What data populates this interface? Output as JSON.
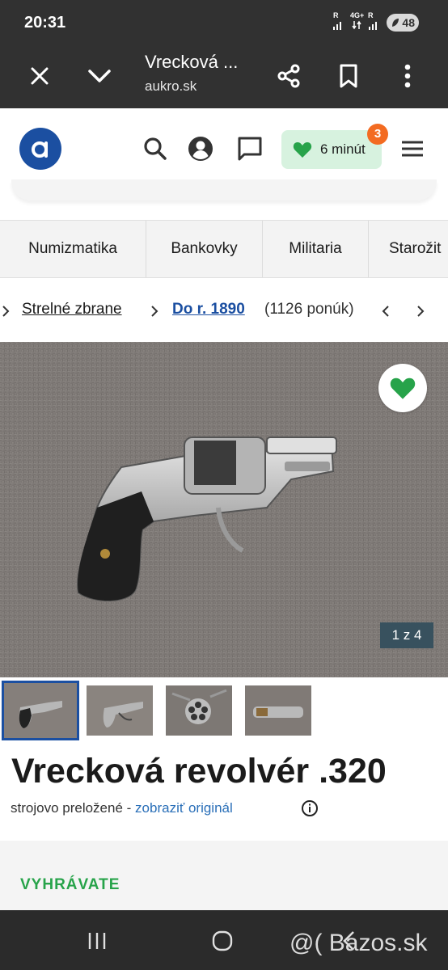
{
  "status_bar": {
    "time": "20:31",
    "battery": "48",
    "network_labels": [
      "R",
      "4G+",
      "R"
    ]
  },
  "browser": {
    "title": "Vrecková ...",
    "url": "aukro.sk"
  },
  "header": {
    "watch_timer": "6 minút",
    "badge": "3"
  },
  "categories": [
    "Numizmatika",
    "Bankovky",
    "Militaria",
    "Starožit"
  ],
  "breadcrumb": {
    "parent": "Strelné zbrane",
    "current": "Do r. 1890",
    "count": "(1126 ponúk)"
  },
  "gallery": {
    "counter": "1 z 4",
    "thumbnails": 4
  },
  "listing": {
    "title": "Vrecková revolvér .320",
    "translated_text": "strojovo preložené -",
    "show_original": "zobraziť originál"
  },
  "auction": {
    "status": "VYHRÁVATE"
  },
  "watermark": "@( Bazos.sk",
  "colors": {
    "brand_blue": "#1b4fa1",
    "winning_green": "#27a34a",
    "badge_orange": "#f36b21",
    "watch_bg": "#d7f2df"
  },
  "icons": [
    "close-icon",
    "chevron-down-icon",
    "share-icon",
    "bookmark-icon",
    "more-vert-icon",
    "search-icon",
    "account-icon",
    "chat-icon",
    "heart-icon",
    "menu-icon",
    "info-icon"
  ]
}
